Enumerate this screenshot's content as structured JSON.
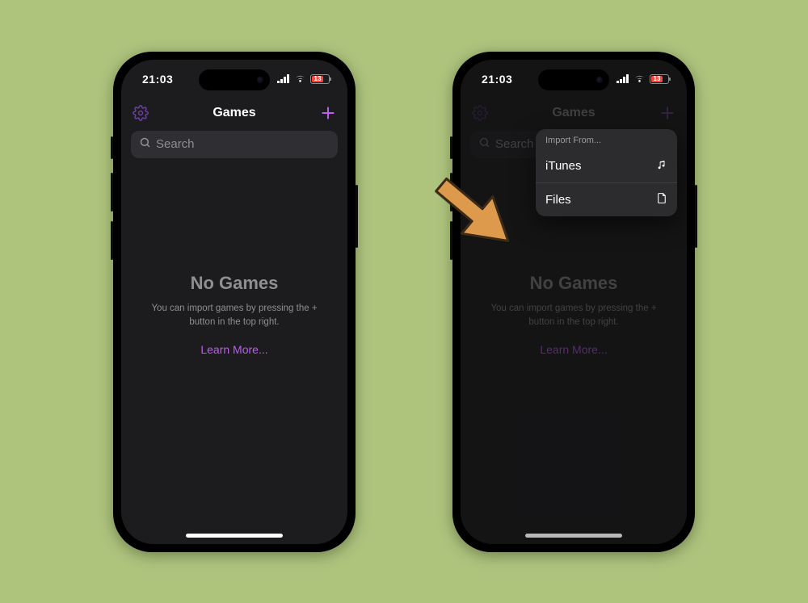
{
  "statusbar": {
    "time": "21:03",
    "battery_text": "13"
  },
  "nav": {
    "title": "Games"
  },
  "search": {
    "placeholder": "Search"
  },
  "empty": {
    "title": "No Games",
    "subtitle": "You can import games by pressing the + button in the top right.",
    "learn_more": "Learn More..."
  },
  "popover": {
    "header": "Import From...",
    "items": [
      {
        "label": "iTunes",
        "icon": "music-note-icon"
      },
      {
        "label": "Files",
        "icon": "document-icon"
      }
    ]
  }
}
